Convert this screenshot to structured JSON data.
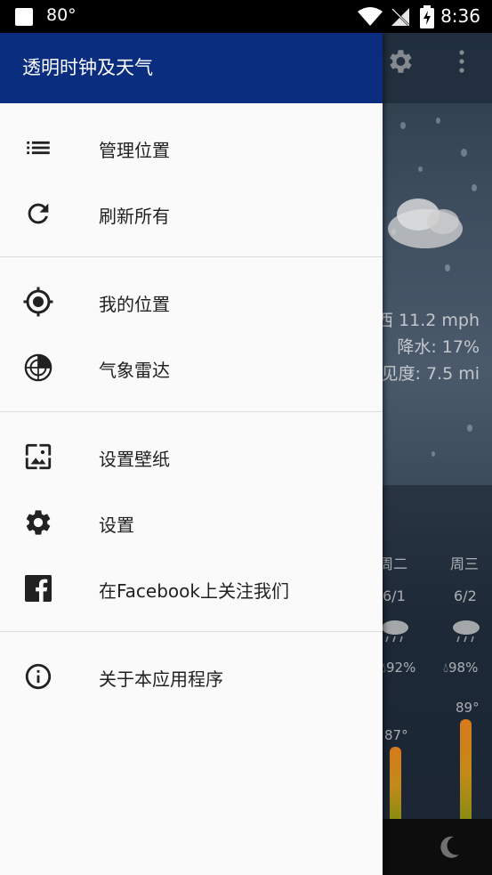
{
  "status_bar": {
    "temperature": "80°",
    "time": "8:36"
  },
  "drawer": {
    "title": "透明时钟及天气",
    "groups": [
      {
        "items": [
          {
            "icon": "list-icon",
            "label": "管理位置"
          },
          {
            "icon": "refresh-icon",
            "label": "刷新所有"
          }
        ]
      },
      {
        "items": [
          {
            "icon": "my-location-icon",
            "label": "我的位置"
          },
          {
            "icon": "radar-icon",
            "label": "气象雷达"
          }
        ]
      },
      {
        "items": [
          {
            "icon": "wallpaper-icon",
            "label": "设置壁纸"
          },
          {
            "icon": "gear-icon",
            "label": "设置"
          },
          {
            "icon": "facebook-icon",
            "label": "在Facebook上关注我们"
          }
        ]
      },
      {
        "items": [
          {
            "icon": "info-icon",
            "label": "关于本应用程序"
          }
        ]
      }
    ]
  },
  "background_app": {
    "wind": "西 11.2 mph",
    "precipitation": "降水: 17%",
    "visibility": "见度: 7.5 mi",
    "forecast": [
      {
        "day": "周二",
        "date": "6/1",
        "humidity": "92%",
        "high": "87°"
      },
      {
        "day": "周三",
        "date": "6/2",
        "humidity": "98%",
        "high": "89°"
      }
    ]
  }
}
